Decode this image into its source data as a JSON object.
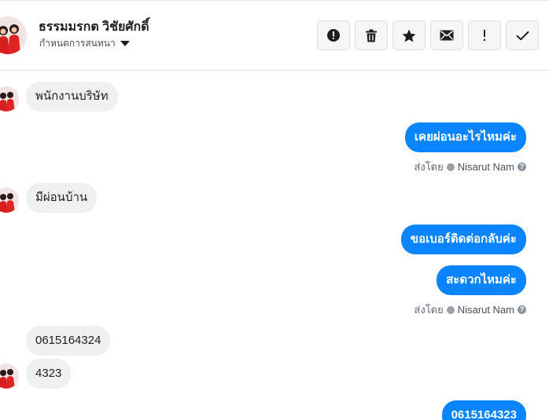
{
  "header": {
    "name": "ธรรมมรกต วิชัยศักดิ์",
    "assign_label": "กำหนดการสนทนา",
    "actions": [
      {
        "icon": "alert-circle-icon",
        "label": "Mark as spam"
      },
      {
        "icon": "trash-icon",
        "label": "Delete"
      },
      {
        "icon": "star-icon",
        "label": "Follow up"
      },
      {
        "icon": "envelope-icon",
        "label": "Mark as unread"
      },
      {
        "icon": "exclamation-icon",
        "label": "Important"
      },
      {
        "icon": "check-icon",
        "label": "Done"
      }
    ]
  },
  "messages": [
    {
      "dir": "in",
      "text": "พนักงานบริษัท"
    },
    {
      "dir": "out",
      "text": "เคยผ่อนอะไรไหมค่ะ"
    },
    {
      "dir": "in",
      "text": "มีผ่อนบ้าน"
    },
    {
      "dir": "out",
      "text": "ขอเบอร์ติดต่อกลับค่ะ"
    },
    {
      "dir": "out",
      "text": "สะดวกไหมค่ะ"
    },
    {
      "dir": "in",
      "text": "0615164324"
    },
    {
      "dir": "in",
      "text": "4323"
    },
    {
      "dir": "out",
      "text": "0615164323"
    }
  ],
  "sent_by": {
    "prefix": "ส่งโดย",
    "agent": "Nisarut Nam"
  },
  "colors": {
    "outgoing_bubble": "#0a84ff",
    "incoming_bubble": "#f0f0f0"
  }
}
